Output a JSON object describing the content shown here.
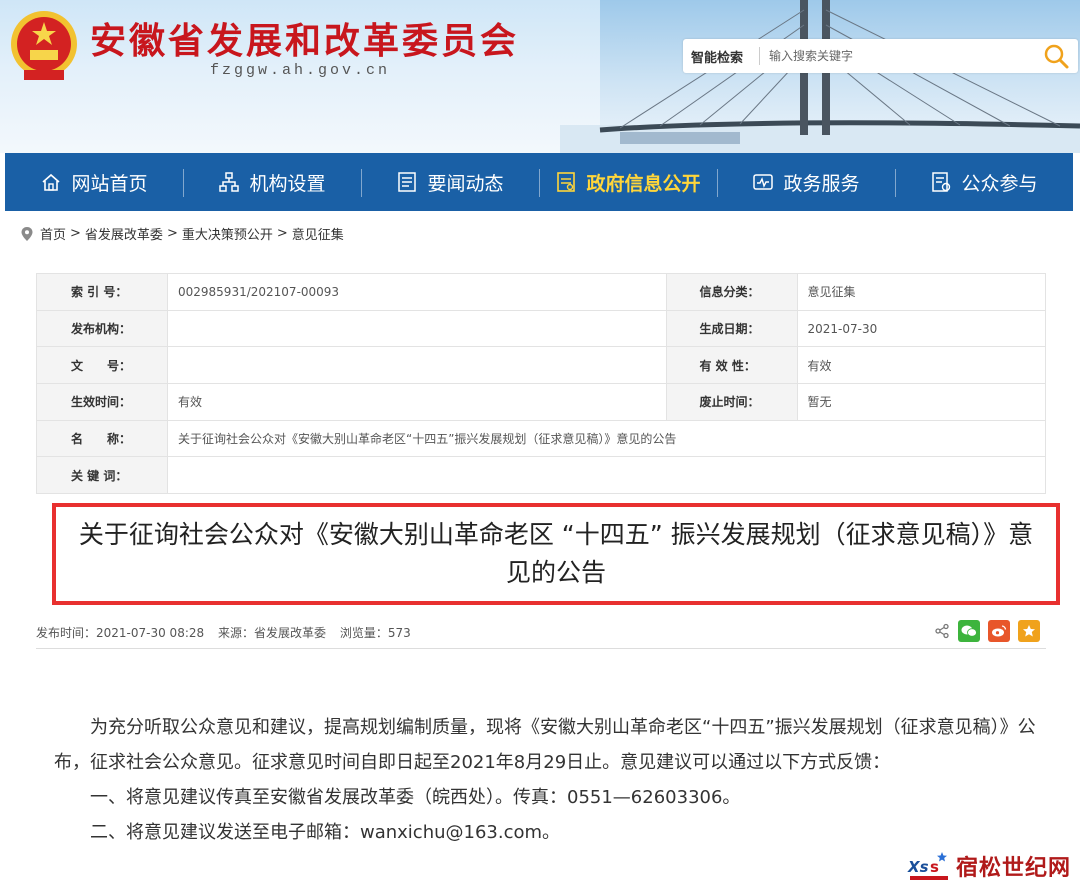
{
  "header": {
    "site_title": "安徽省发展和改革委员会",
    "site_url": "fzggw.ah.gov.cn",
    "search": {
      "smart_label": "智能检索",
      "placeholder": "输入搜索关键字"
    }
  },
  "nav": [
    {
      "label": "网站首页",
      "icon": "home-icon"
    },
    {
      "label": "机构设置",
      "icon": "org-chart-icon"
    },
    {
      "label": "要闻动态",
      "icon": "news-icon"
    },
    {
      "label": "政府信息公开",
      "icon": "info-public-icon",
      "active": true
    },
    {
      "label": "政务服务",
      "icon": "service-icon"
    },
    {
      "label": "公众参与",
      "icon": "participation-icon"
    }
  ],
  "breadcrumb": [
    "首页",
    "省发展改革委",
    "重大决策预公开",
    "意见征集"
  ],
  "meta": {
    "index_label": "索 引 号：",
    "index_value": "002985931/202107-00093",
    "category_label": "信息分类：",
    "category_value": "意见征集",
    "publisher_label": "发布机构：",
    "publisher_value": "",
    "date_label": "生成日期：",
    "date_value": "2021-07-30",
    "docno_label": "文　　号：",
    "docno_value": "",
    "validity_label": "有 效 性：",
    "validity_value": "有效",
    "effective_label": "生效时间：",
    "effective_value": "有效",
    "abolish_label": "废止时间：",
    "abolish_value": "暂无",
    "name_label": "名　　称：",
    "name_value": "关于征询社会公众对《安徽大别山革命老区“十四五”振兴发展规划（征求意见稿）》意见的公告",
    "keywords_label": "关 键 词：",
    "keywords_value": ""
  },
  "article": {
    "title": "关于征询社会公众对《安徽大别山革命老区 “十四五” 振兴发展规划（征求意见稿）》意见的公告",
    "publish_time": "发布时间：2021-07-30 08:28",
    "source": "来源：省发展改革委",
    "views": "浏览量：573",
    "paragraph1": "为充分听取公众意见和建议，提高规划编制质量，现将《安徽大别山革命老区“十四五”振兴发展规划（征求意见稿）》公布，征求社会公众意见。征求意见时间自即日起至2021年8月29日止。意见建议可以通过以下方式反馈：",
    "item1": "一、将意见建议传真至安徽省发展改革委（皖西处）。传真：0551—62603306。",
    "item2": "二、将意见建议发送至电子邮箱：wanxichu@163.com。"
  },
  "watermark": {
    "text": "宿松世纪网"
  },
  "colors": {
    "nav_bg": "#1a60a6",
    "nav_active": "#ffd63a",
    "title_red": "#c8161d",
    "highlight_border": "#e8302f"
  }
}
